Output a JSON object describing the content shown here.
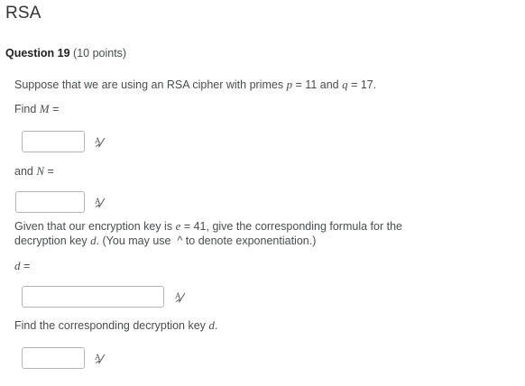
{
  "page": {
    "title": "RSA"
  },
  "question": {
    "label": "Question 19",
    "points": "(10 points)"
  },
  "intro": {
    "before_p": "Suppose that we are using an RSA cipher with primes ",
    "p_var": "p",
    "p_eq": " = 11 and ",
    "q_var": "q",
    "q_eq": " = 17."
  },
  "find_m": {
    "prefix": "Find ",
    "var": "M",
    "suffix": " ="
  },
  "and_n": {
    "prefix": "and ",
    "var": "N",
    "suffix": " ="
  },
  "given": {
    "line1_before_e": "Given that our encryption key is ",
    "e_var": "e",
    "line1_after_e": " = 41, give the corresponding formula for the",
    "line2_before_d": "decryption key ",
    "d_var": "d",
    "line2_after_d": ". (You may use ",
    "caret": "^",
    "line2_end": " to denote exponentiation.)"
  },
  "d_label": {
    "var": "d",
    "suffix": " ="
  },
  "find_d": {
    "prefix": "Find the corresponding decryption key ",
    "var": "d",
    "suffix": "."
  },
  "inputs": {
    "m_value": "",
    "n_value": "",
    "d_formula_value": "",
    "d_value": ""
  },
  "icons": {
    "equation_editor": "equation-editor-icon"
  }
}
